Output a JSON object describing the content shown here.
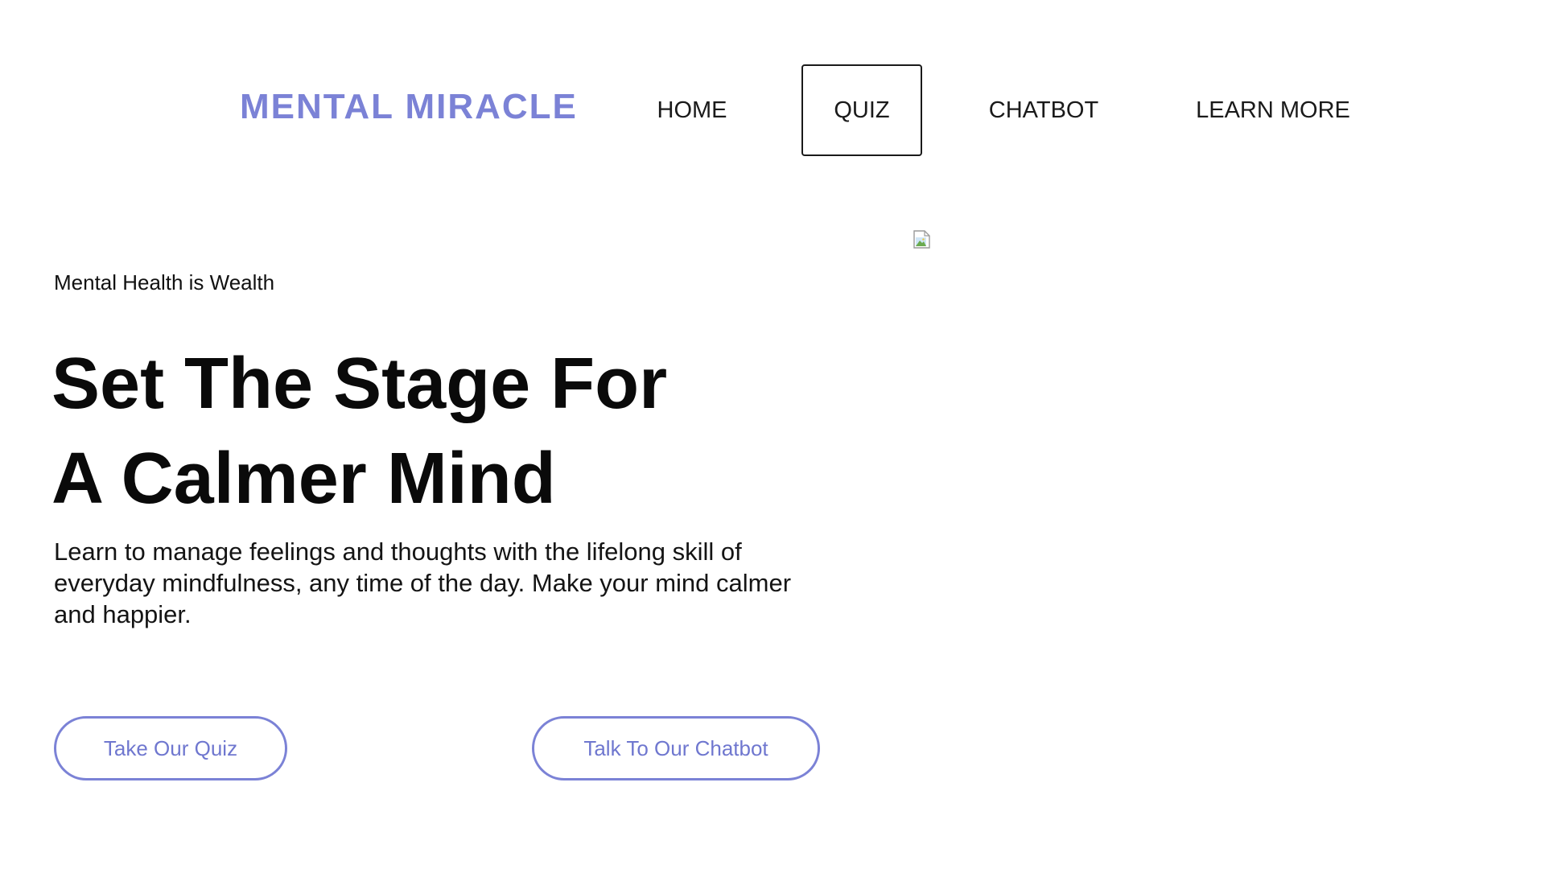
{
  "header": {
    "brand": "MENTAL MIRACLE",
    "nav": {
      "home": "HOME",
      "quiz": "QUIZ",
      "chatbot": "CHATBOT",
      "learn_more": "LEARN MORE"
    },
    "active_nav": "quiz"
  },
  "hero": {
    "tagline": "Mental Health is Wealth",
    "headline_line1": "Set The Stage For",
    "headline_line2": "A Calmer Mind",
    "description": "Learn to manage feelings and thoughts with the lifelong skill of everyday mindfulness, any time of the day. Make your mind calmer and happier.",
    "image_icon": "broken-image-icon",
    "buttons": {
      "quiz": "Take Our Quiz",
      "chatbot": "Talk To Our Chatbot"
    }
  },
  "colors": {
    "accent": "#7b82d6",
    "text": "#111111",
    "background": "#ffffff"
  }
}
